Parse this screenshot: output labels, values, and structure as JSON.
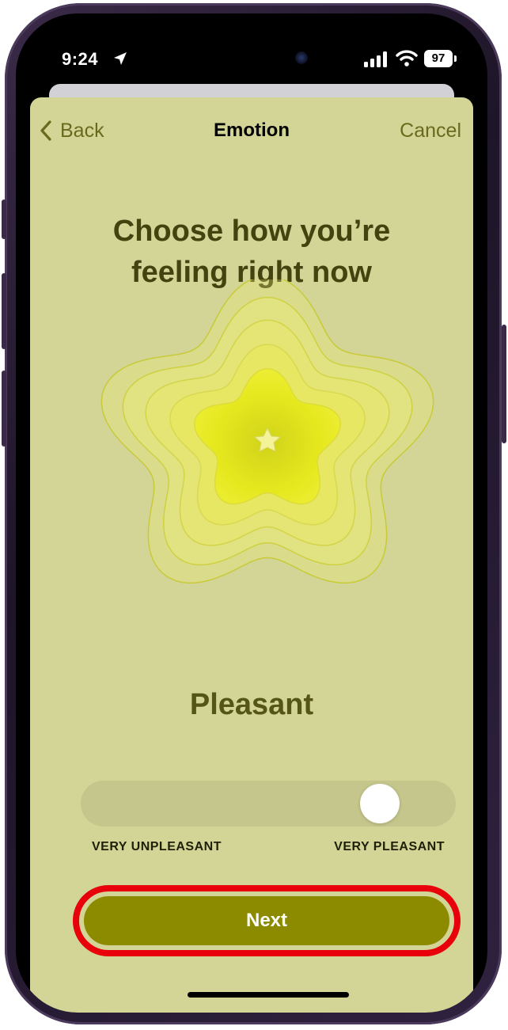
{
  "status_bar": {
    "time": "9:24",
    "battery": "97"
  },
  "nav": {
    "back_label": "Back",
    "title": "Emotion",
    "cancel_label": "Cancel"
  },
  "headline": "Choose how you’re feeling right now",
  "mood": {
    "label": "Pleasant",
    "slider_value_fraction": 0.84,
    "slider_min_label": "VERY UNPLEASANT",
    "slider_max_label": "VERY PLEASANT"
  },
  "next_button_label": "Next",
  "colors": {
    "sheet_background": "#d2d596",
    "accent": "#6a6a1e",
    "button": "#8c8b00",
    "highlight": "#e8000b",
    "flower_core": "#e6e81e"
  }
}
